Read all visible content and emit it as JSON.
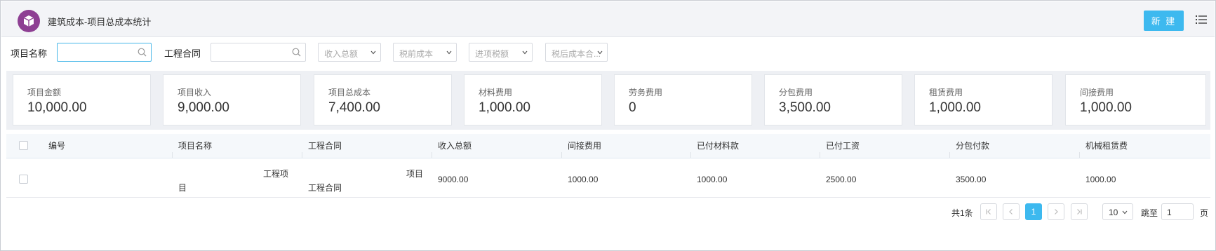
{
  "header": {
    "title": "建筑成本-项目总成本统计",
    "new_label": "新 建",
    "logo_icon": "box-icon",
    "menu_icon": "list-icon",
    "brand_color": "#8e3f93",
    "accent_color": "#3db9ef"
  },
  "filters": {
    "project_name_label": "项目名称",
    "project_name_value": "",
    "contract_label": "工程合同",
    "contract_value": "",
    "selects": [
      "收入总额",
      "税前成本",
      "进项税额",
      "税后成本合..."
    ]
  },
  "cards": [
    {
      "label": "项目金额",
      "value": "10,000.00"
    },
    {
      "label": "项目收入",
      "value": "9,000.00"
    },
    {
      "label": "项目总成本",
      "value": "7,400.00"
    },
    {
      "label": "材料费用",
      "value": "1,000.00"
    },
    {
      "label": "劳务费用",
      "value": "0"
    },
    {
      "label": "分包费用",
      "value": "3,500.00"
    },
    {
      "label": "租赁费用",
      "value": "1,000.00"
    },
    {
      "label": "间接费用",
      "value": "1,000.00"
    }
  ],
  "table": {
    "columns": [
      "编号",
      "项目名称",
      "工程合同",
      "收入总额",
      "间接费用",
      "已付材料款",
      "已付工资",
      "分包付款",
      "机械租赁费"
    ],
    "rows": [
      {
        "id": "",
        "project_name_part1": "工程项",
        "project_name_part2": "目",
        "contract_part1": "项目",
        "contract_part2": "工程合同",
        "income": "9000.00",
        "indirect": "1000.00",
        "material_paid": "1000.00",
        "wages_paid": "2500.00",
        "subcontract_paid": "3500.00",
        "machine_rent": "1000.00"
      }
    ]
  },
  "pagination": {
    "total": "共1条",
    "current_page": "1",
    "page_size": "10",
    "jump_label": "跳至",
    "jump_value": "1",
    "page_unit": "页"
  }
}
